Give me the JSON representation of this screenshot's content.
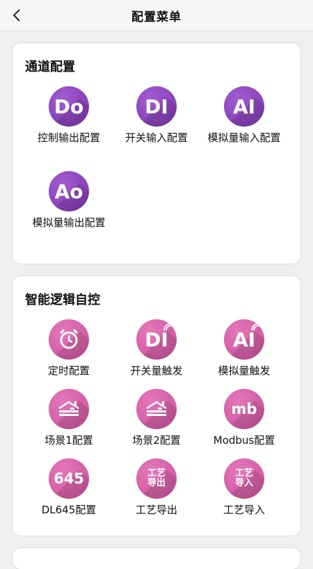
{
  "header": {
    "title": "配置菜单"
  },
  "sections": [
    {
      "title": "通道配置",
      "items": [
        {
          "icon_text": "Do",
          "label": "控制输出配置",
          "icon": "do-icon"
        },
        {
          "icon_text": "DI",
          "label": "开关输入配置",
          "icon": "di-icon"
        },
        {
          "icon_text": "AI",
          "label": "模拟量输入配置",
          "icon": "ai-icon"
        },
        {
          "icon_text": "Ao",
          "label": "模拟量输出配置",
          "icon": "ao-icon"
        }
      ]
    },
    {
      "title": "智能逻辑自控",
      "items": [
        {
          "icon_text": "",
          "label": "定时配置",
          "icon": "alarm-clock-icon"
        },
        {
          "icon_text": "DI",
          "label": "开关量触发",
          "icon": "di-trigger-icon"
        },
        {
          "icon_text": "AI",
          "label": "模拟量触发",
          "icon": "ai-trigger-icon"
        },
        {
          "icon_text": "",
          "label": "场景1配置",
          "icon": "scene-house-icon"
        },
        {
          "icon_text": "",
          "label": "场景2配置",
          "icon": "scene-house-icon"
        },
        {
          "icon_text": "mb",
          "label": "Modbus配置",
          "icon": "modbus-icon"
        },
        {
          "icon_text": "645",
          "label": "DL645配置",
          "icon": "dl645-icon"
        },
        {
          "icon_text": "工艺 导出",
          "label": "工艺导出",
          "icon": "process-export-icon"
        },
        {
          "icon_text": "工艺 导入",
          "label": "工艺导入",
          "icon": "process-import-icon"
        }
      ]
    }
  ],
  "colors": {
    "purple": "#8c44bd",
    "pink": "#d861a9",
    "background": "#efefef"
  }
}
